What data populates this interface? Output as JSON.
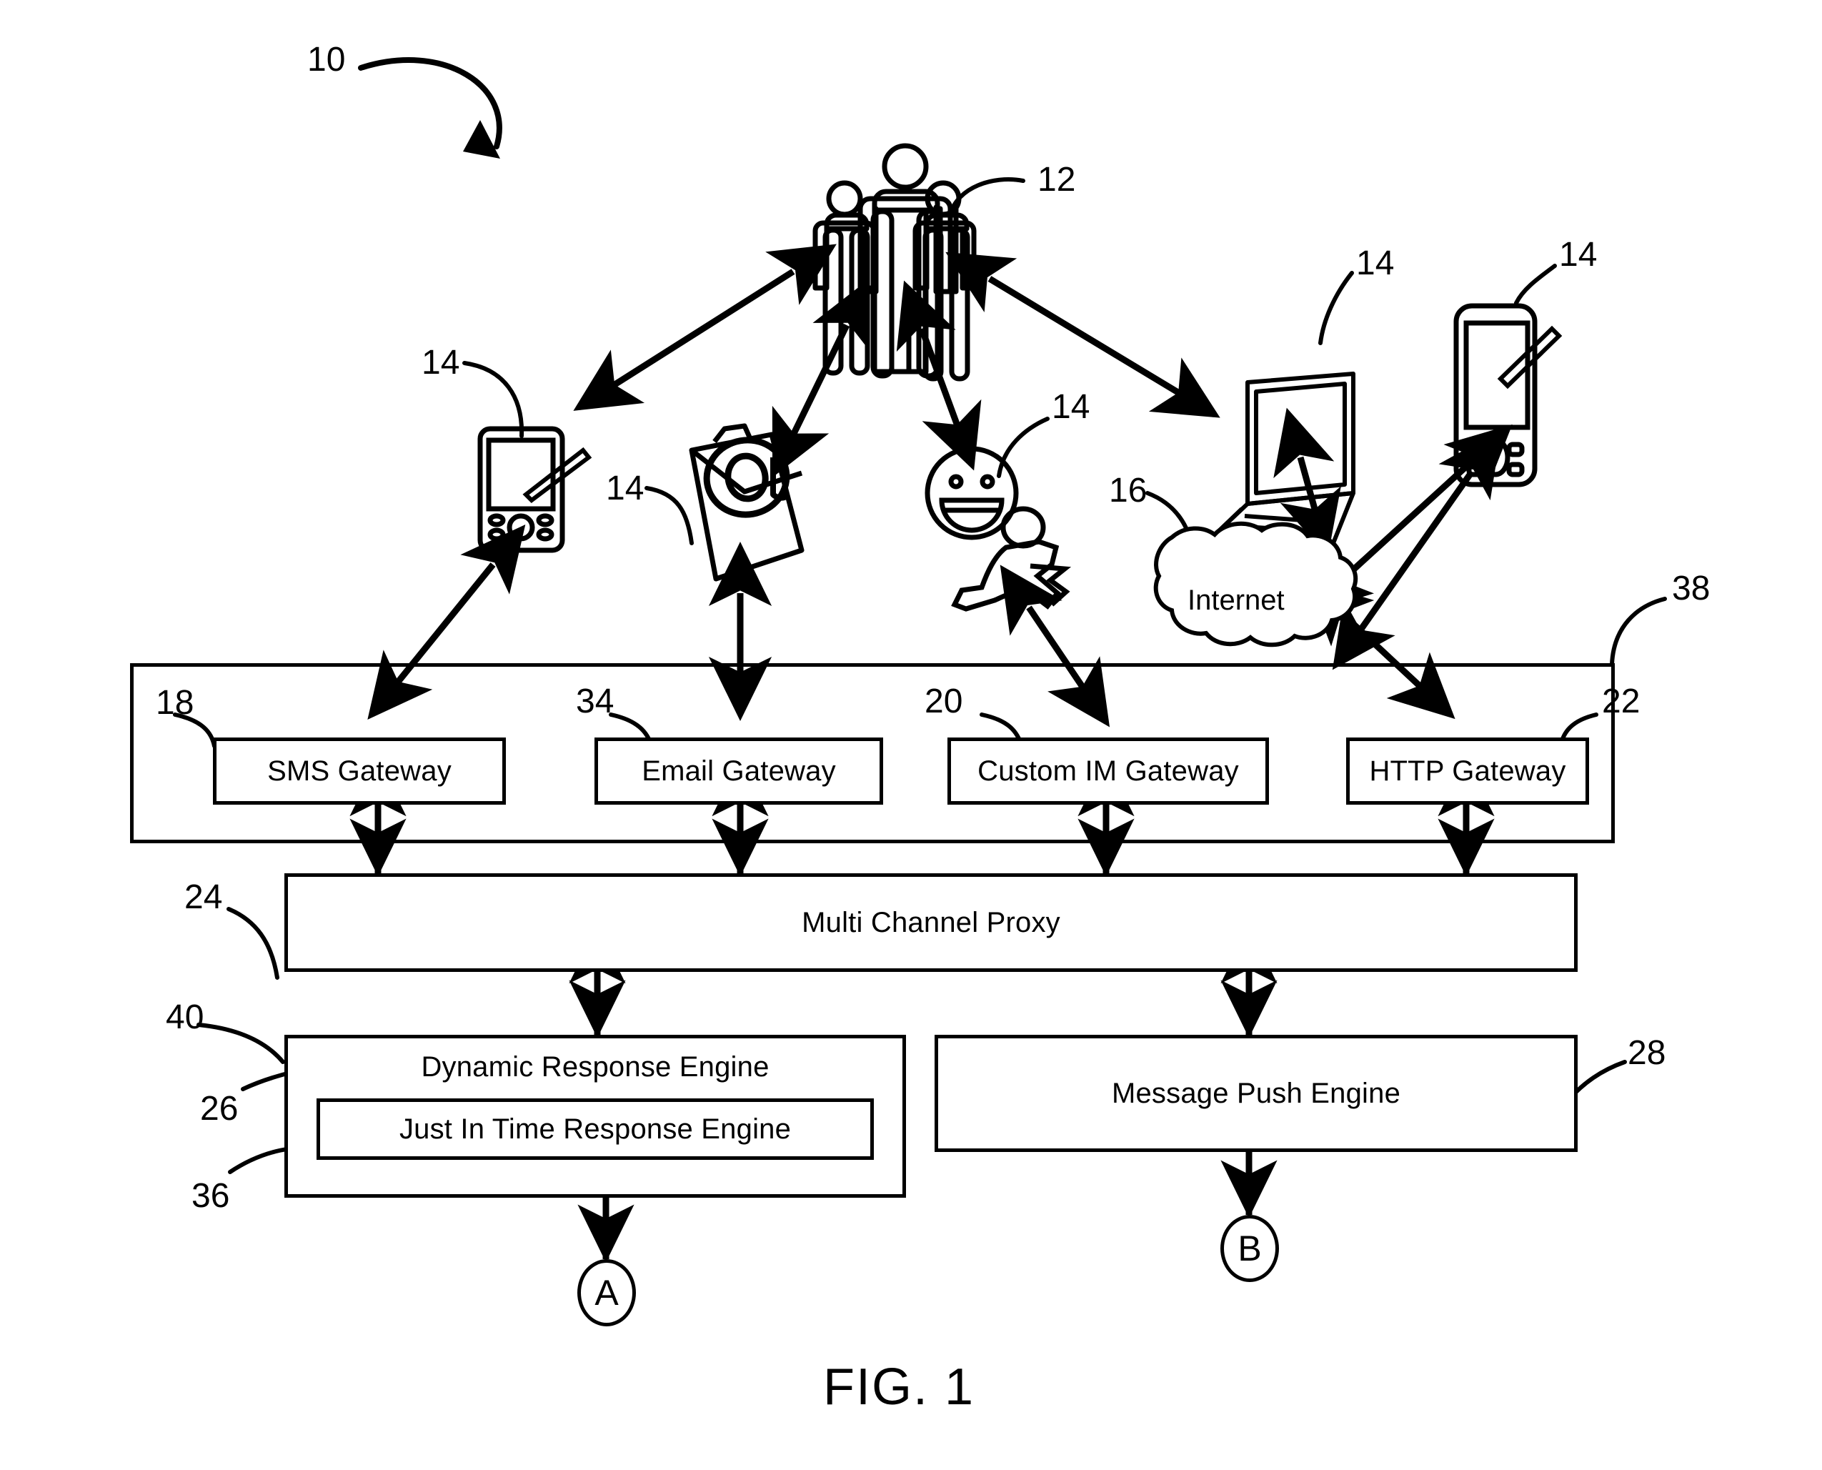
{
  "figure": {
    "caption": "FIG. 1",
    "system_ref": "10"
  },
  "actors": {
    "users_ref": "12",
    "users_icon": "people-group-icon"
  },
  "devices": [
    {
      "name": "pda-left",
      "icon": "pda-stylus-icon",
      "ref": "14"
    },
    {
      "name": "email-envelope",
      "icon": "email-envelope-at-icon",
      "ref": "14"
    },
    {
      "name": "instant-messenger",
      "icon": "smiley-running-man-icon",
      "ref": "14"
    },
    {
      "name": "laptop",
      "icon": "laptop-icon",
      "ref": "14"
    },
    {
      "name": "pda-right",
      "icon": "pda-stylus-icon",
      "ref": "14"
    }
  ],
  "network": {
    "cloud_label": "Internet",
    "cloud_ref": "16",
    "cloud_icon": "cloud-icon"
  },
  "gateway_container": {
    "ref": "38",
    "gateways": [
      {
        "label": "SMS Gateway",
        "ref": "18"
      },
      {
        "label": "Email Gateway",
        "ref": "34"
      },
      {
        "label": "Custom IM Gateway",
        "ref": "20"
      },
      {
        "label": "HTTP Gateway",
        "ref": "22"
      }
    ]
  },
  "proxy": {
    "label": "Multi Channel Proxy",
    "ref": "24"
  },
  "engines": {
    "dynamic_response": {
      "label": "Dynamic Response Engine",
      "ref": "40",
      "outer_ref": "26",
      "inner": {
        "label": "Just In Time Response Engine",
        "ref": "36"
      }
    },
    "message_push": {
      "label": "Message Push Engine",
      "ref": "28"
    }
  },
  "connectors": [
    {
      "name": "connector-a",
      "label": "A"
    },
    {
      "name": "connector-b",
      "label": "B"
    }
  ],
  "colors": {
    "ink": "#000000",
    "paper": "#ffffff"
  }
}
